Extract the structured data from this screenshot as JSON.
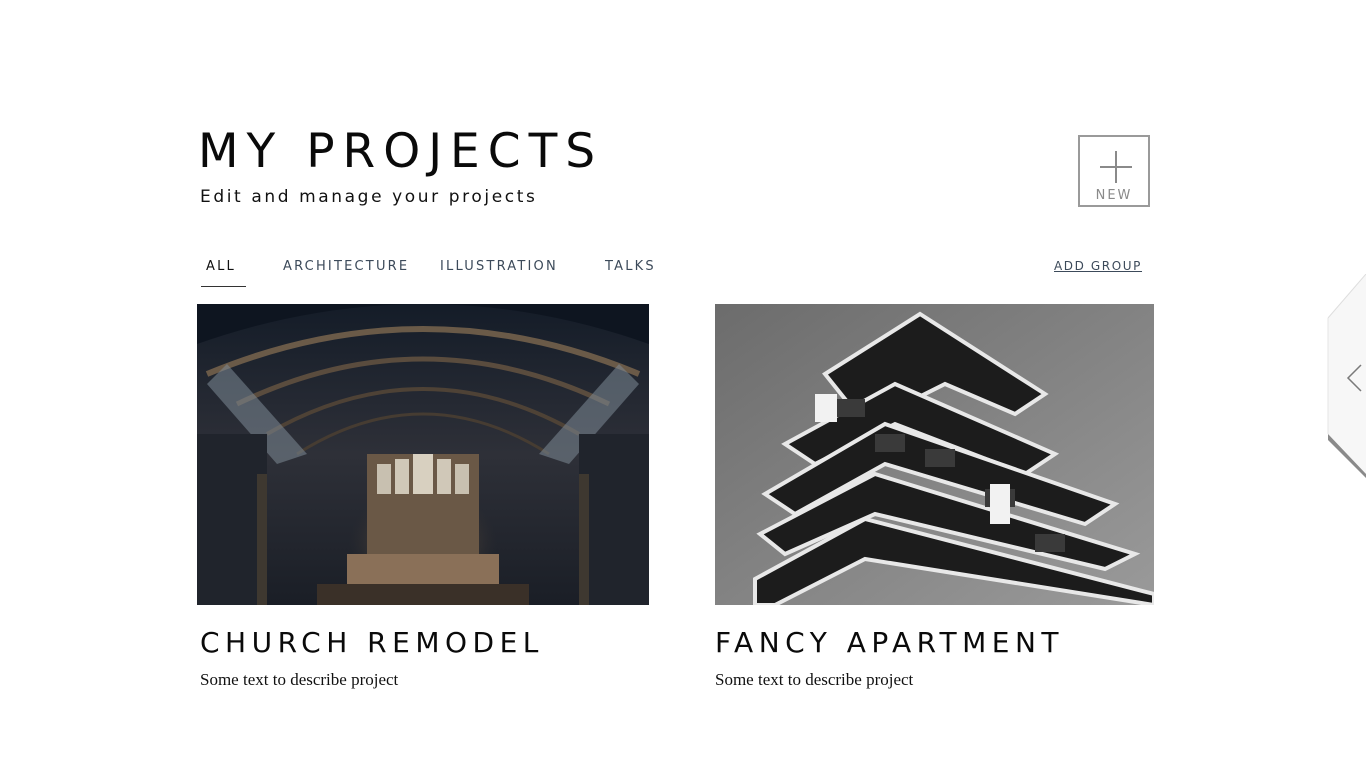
{
  "header": {
    "title": "MY PROJECTS",
    "subtitle": "Edit and manage your projects",
    "new_button_label": "NEW"
  },
  "tabs": [
    {
      "label": "ALL",
      "active": true
    },
    {
      "label": "ARCHITECTURE",
      "active": false
    },
    {
      "label": "ILLUSTRATION",
      "active": false
    },
    {
      "label": "TALKS",
      "active": false
    }
  ],
  "add_group_label": "ADD GROUP",
  "projects": [
    {
      "title": "CHURCH REMODEL",
      "description": "Some text to describe project",
      "image": "church-interior-photo"
    },
    {
      "title": "FANCY APARTMENT",
      "description": "Some text to describe project",
      "image": "apartment-building-photo"
    }
  ],
  "icons": {
    "new": "plus-icon",
    "side_tab": "chevron-left-icon"
  },
  "colors": {
    "background": "#ffffff",
    "text": "#111111",
    "tab_text": "#3c4a5a",
    "button_border": "#9a9a9a"
  }
}
